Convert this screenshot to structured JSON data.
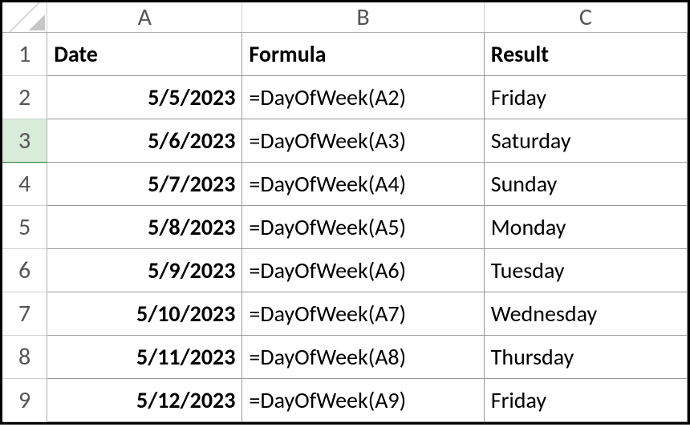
{
  "columns": [
    "A",
    "B",
    "C"
  ],
  "rowNumbers": [
    "1",
    "2",
    "3",
    "4",
    "5",
    "6",
    "7",
    "8",
    "9"
  ],
  "selectedRow": "3",
  "headers": {
    "A": "Date",
    "B": "Formula",
    "C": "Result"
  },
  "rows": [
    {
      "date": "5/5/2023",
      "formula": "=DayOfWeek(A2)",
      "result": "Friday"
    },
    {
      "date": "5/6/2023",
      "formula": "=DayOfWeek(A3)",
      "result": "Saturday"
    },
    {
      "date": "5/7/2023",
      "formula": "=DayOfWeek(A4)",
      "result": "Sunday"
    },
    {
      "date": "5/8/2023",
      "formula": "=DayOfWeek(A5)",
      "result": "Monday"
    },
    {
      "date": "5/9/2023",
      "formula": "=DayOfWeek(A6)",
      "result": "Tuesday"
    },
    {
      "date": "5/10/2023",
      "formula": "=DayOfWeek(A7)",
      "result": "Wednesday"
    },
    {
      "date": "5/11/2023",
      "formula": "=DayOfWeek(A8)",
      "result": "Thursday"
    },
    {
      "date": "5/12/2023",
      "formula": "=DayOfWeek(A9)",
      "result": "Friday"
    }
  ]
}
